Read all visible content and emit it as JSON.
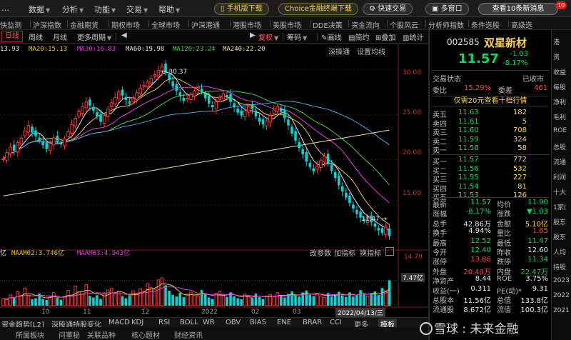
{
  "menubar": {
    "items": [
      "…",
      "数据",
      "分析",
      "功能",
      "交易",
      "帮助"
    ],
    "mobile_btn": "手机版下载",
    "choice_btn": "Choice金融终端下载",
    "quick_trade": "快速交易",
    "multiscreen": "多窗口",
    "news_btn": "查看10条新消息",
    "news_count": "10"
  },
  "navbar": {
    "items": [
      "快监测",
      "沪深指数",
      "金融期货",
      "期权市场",
      "全球市场",
      "沪深港通",
      "港股市场",
      "美股市场",
      "DDE决策",
      "资金流向",
      "个股风云",
      "分析师指数",
      "条件选股",
      "高级选"
    ]
  },
  "toolbar": {
    "items": [
      "日线",
      "周线",
      "月线",
      "更多周期",
      "复权",
      "画线",
      "简约",
      "叠加",
      "统计",
      "筹码",
      "画线",
      "简约",
      "叠加",
      "统计"
    ],
    "period_items": [
      "日线",
      "周线",
      "月线",
      "更多周期"
    ],
    "right_items": [
      "复权",
      "筹码",
      "画线",
      "简约",
      "叠加",
      "统计"
    ],
    "scroll_arrows": [
      "◀",
      "▶"
    ]
  },
  "ma": {
    "ma10": "13.93",
    "ma20": "MA20:15.13",
    "ma30": "MA30:16.83",
    "ma60": "MA60:19.98",
    "ma120": "MA120:23.24",
    "ma240": "MA240:22.20"
  },
  "chart_controls": {
    "depth": "深操通",
    "set_ma": "设置均线",
    "params": "改参数",
    "add_ind": "加指标",
    "switch_ind": "换指标"
  },
  "vma": {
    "label0": "亿",
    "maam02": "MAAM02:3.746亿",
    "maam03": "MAAM03:4.943亿"
  },
  "colors": {
    "up": "#ff3333",
    "down": "#00d8d8",
    "ma_white": "#e8e8e8",
    "ma_yellow": "#e8c830",
    "ma_magenta": "#e040e0",
    "ma_green": "#40d040",
    "ma_cyan": "#40a8e0",
    "ma_orange": "#f0e0a0"
  },
  "chart_data": {
    "type": "candlestick",
    "ylim": [
      10.5,
      31.5
    ],
    "y_ticks": [
      "30.00",
      "25.00",
      "20.00",
      "15.00"
    ],
    "vol_ticks": [
      "14.70",
      "7.47亿"
    ],
    "x_ticks": [
      "10",
      "11",
      "12",
      "2022",
      "02",
      "03"
    ],
    "hover_date": "2022/04/13/三",
    "max_label": "30.37",
    "min_label": "11.47",
    "volume_max": 14.7,
    "closes": [
      20.1,
      20.8,
      21.4,
      21.0,
      21.9,
      22.4,
      23.2,
      23.8,
      23.0,
      22.6,
      22.1,
      21.6,
      21.2,
      21.8,
      22.4,
      22.0,
      21.7,
      22.3,
      23.1,
      23.9,
      24.6,
      25.3,
      25.9,
      26.4,
      26.0,
      25.4,
      24.8,
      24.2,
      24.9,
      25.6,
      26.3,
      26.9,
      27.5,
      27.1,
      26.6,
      26.2,
      26.8,
      27.4,
      27.9,
      28.2,
      28.6,
      29.0,
      29.4,
      29.9,
      30.37,
      29.6,
      28.8,
      28.1,
      27.6,
      27.0,
      26.5,
      26.8,
      27.2,
      27.6,
      28.0,
      27.5,
      26.8,
      26.2,
      25.8,
      26.4,
      26.9,
      27.3,
      27.0,
      26.4,
      25.8,
      25.2,
      24.9,
      25.4,
      25.9,
      25.6,
      24.8,
      24.2,
      23.9,
      24.3,
      24.9,
      25.5,
      25.9,
      25.3,
      24.6,
      23.8,
      22.9,
      22.1,
      21.3,
      20.6,
      19.8,
      19.2,
      18.7,
      19.3,
      19.9,
      20.4,
      19.6,
      18.8,
      18.0,
      17.2,
      16.5,
      15.8,
      15.2,
      14.6,
      14.0,
      13.6,
      13.2,
      13.6,
      13.1,
      12.6,
      12.2,
      11.9,
      12.55,
      11.57
    ],
    "volumes": [
      2.1,
      1.8,
      3.2,
      2.4,
      4.1,
      3.0,
      5.2,
      2.8,
      1.9,
      2.2,
      3.6,
      2.0,
      1.7,
      2.6,
      3.9,
      2.3,
      1.8,
      2.7,
      4.5,
      3.2,
      5.8,
      4.1,
      3.3,
      6.2,
      2.9,
      2.4,
      3.1,
      2.0,
      3.8,
      4.6,
      5.1,
      3.5,
      4.2,
      2.8,
      2.2,
      3.0,
      4.4,
      3.6,
      5.0,
      4.1,
      6.5,
      5.3,
      4.8,
      7.6,
      8.2,
      6.0,
      4.4,
      3.2,
      2.7,
      3.8,
      2.5,
      3.4,
      4.0,
      3.1,
      2.9,
      4.6,
      3.3,
      2.4,
      2.0,
      3.7,
      4.3,
      3.0,
      2.6,
      3.9,
      2.8,
      2.2,
      1.9,
      3.4,
      2.7,
      2.3,
      3.6,
      2.5,
      2.0,
      2.9,
      3.3,
      2.6,
      3.8,
      2.9,
      2.4,
      3.5,
      4.2,
      3.0,
      2.7,
      3.9,
      4.5,
      3.2,
      2.8,
      3.6,
      2.9,
      2.4,
      3.7,
      2.8,
      3.3,
      4.1,
      3.0,
      2.6,
      3.9,
      2.7,
      3.2,
      4.6,
      3.4,
      2.8,
      3.7,
      4.2,
      3.1,
      5.2,
      4.4,
      7.47
    ]
  },
  "bottom": {
    "ind_tabs": [
      "资金趋势[L2]",
      "深股通持股变化",
      "MACD",
      "KDJ",
      "RSI",
      "BOLL",
      "WR",
      "OBV",
      "BIAS",
      "ENE",
      "BRAR",
      "CCI",
      "更多",
      "模板"
    ],
    "btm_tabs": [
      "所属板块",
      "问董秘",
      "关联品种",
      "核心题材",
      "财经资讯"
    ]
  },
  "quote": {
    "code": "002585",
    "name": "双星新材",
    "price": "11.57",
    "change": "-1.03",
    "change_pct": "-8.17%",
    "status_label": "交易状态",
    "status_value": "已收市",
    "wb_label": "委比",
    "wb_value": "15.29%",
    "wc_label": "委差",
    "wc_value": "461",
    "l2_link": "仅需20元查看十档行情",
    "asks": [
      {
        "label": "卖五",
        "price": "11.63",
        "vol": "182"
      },
      {
        "label": "卖四",
        "price": "11.61",
        "vol": "5"
      },
      {
        "label": "卖三",
        "price": "11.60",
        "vol": "708"
      },
      {
        "label": "卖二",
        "price": "11.59",
        "vol": "324"
      },
      {
        "label": "卖一",
        "price": "11.58",
        "vol": "58"
      }
    ],
    "bids": [
      {
        "label": "买一",
        "price": "11.57",
        "vol": "772"
      },
      {
        "label": "买二",
        "price": "11.56",
        "vol": "532"
      },
      {
        "label": "买三",
        "price": "11.55",
        "vol": "227"
      },
      {
        "label": "买四",
        "price": "11.54",
        "vol": "81"
      },
      {
        "label": "买五",
        "price": "11.53",
        "vol": "126"
      }
    ],
    "stats": [
      {
        "l1": "最新",
        "v1": "11.57",
        "c1": "g",
        "l2": "均价",
        "v2": "11.90",
        "c2": "g"
      },
      {
        "l1": "涨幅",
        "v1": "-8.17%",
        "c1": "g",
        "l2": "涨跌",
        "v2": "▼1.03",
        "c2": "g"
      },
      {
        "l1": "总手",
        "v1": "42.86万",
        "c1": "w",
        "l2": "金额",
        "v2": "5.10亿",
        "c2": "y"
      },
      {
        "l1": "换手",
        "v1": "4.94%",
        "c1": "w",
        "l2": "量比",
        "v2": "1.65",
        "c2": "r"
      },
      {
        "l1": "最高",
        "v1": "12.52",
        "c1": "g",
        "l2": "最低",
        "v2": "11.47",
        "c2": "g"
      },
      {
        "l1": "今开",
        "v1": "12.40",
        "c1": "g",
        "l2": "昨收",
        "v2": "12.60",
        "c2": "w"
      },
      {
        "l1": "涨停",
        "v1": "13.86",
        "c1": "r",
        "l2": "跌停",
        "v2": "11.34",
        "c2": "g"
      },
      {
        "l1": "外盘",
        "v1": "20.40万",
        "c1": "r",
        "l2": "内盘",
        "v2": "22.47万",
        "c2": "g"
      },
      {
        "l1": "净资产",
        "v1": "8.44",
        "c1": "w",
        "l2": "ROE",
        "v2": "3.75%",
        "c2": "w"
      },
      {
        "l1": "收益(一)",
        "v1": "0.311",
        "c1": "w",
        "l2": "PE(动)*",
        "v2": "9.31",
        "c2": "w"
      },
      {
        "l1": "总股本",
        "v1": "11.56亿",
        "c1": "w",
        "l2": "总值",
        "v2": "133.8亿",
        "c2": "w"
      },
      {
        "l1": "流通股",
        "v1": "8.672亿",
        "c1": "w",
        "l2": "流值",
        "v2": "100.3亿",
        "c2": "w"
      }
    ]
  },
  "far_right": {
    "items": [
      "港",
      "资",
      "收益",
      "每股",
      "净利",
      "毛利",
      "ROE",
      "总股",
      "流通",
      "利润",
      "十大",
      "1家(",
      "股东",
      "股东",
      "人均",
      "持股",
      "2023",
      "2022",
      "2021"
    ]
  },
  "watermark": "雪球 : 未来金融"
}
